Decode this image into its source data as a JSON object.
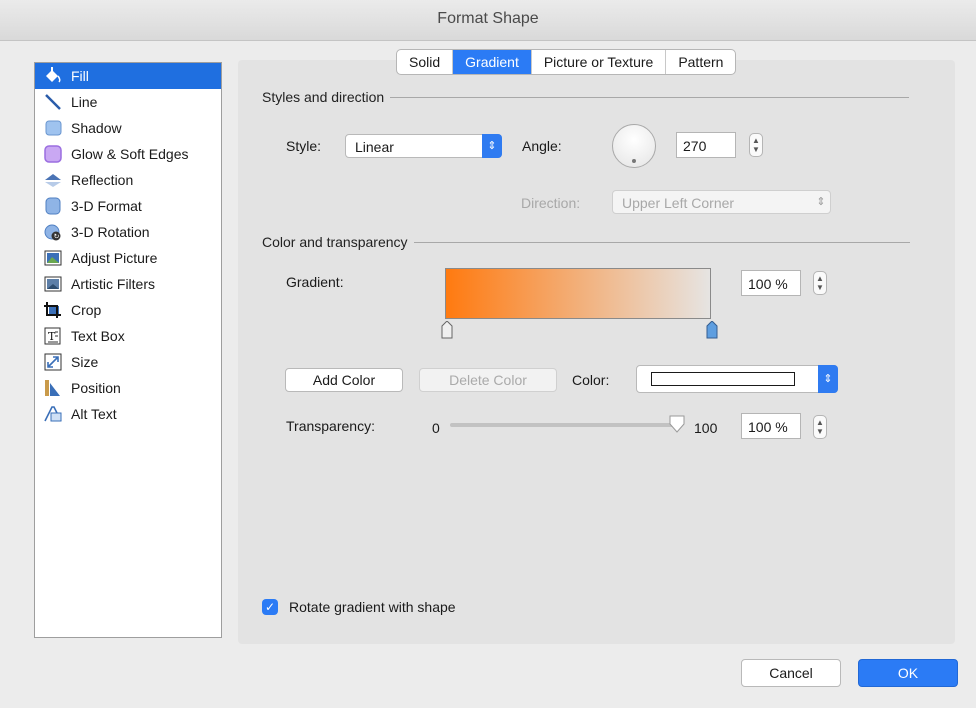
{
  "window": {
    "title": "Format Shape"
  },
  "sidebar": {
    "items": [
      {
        "label": "Fill",
        "icon": "paint-bucket-icon",
        "selected": true
      },
      {
        "label": "Line",
        "icon": "line-icon"
      },
      {
        "label": "Shadow",
        "icon": "shadow-icon"
      },
      {
        "label": "Glow & Soft Edges",
        "icon": "glow-icon"
      },
      {
        "label": "Reflection",
        "icon": "reflection-icon"
      },
      {
        "label": "3-D Format",
        "icon": "3d-format-icon"
      },
      {
        "label": "3-D Rotation",
        "icon": "3d-rotation-icon"
      },
      {
        "label": "Adjust Picture",
        "icon": "adjust-picture-icon"
      },
      {
        "label": "Artistic Filters",
        "icon": "artistic-filters-icon"
      },
      {
        "label": "Crop",
        "icon": "crop-icon"
      },
      {
        "label": "Text Box",
        "icon": "text-box-icon"
      },
      {
        "label": "Size",
        "icon": "size-icon"
      },
      {
        "label": "Position",
        "icon": "position-icon"
      },
      {
        "label": "Alt Text",
        "icon": "alt-text-icon"
      }
    ]
  },
  "tabs": [
    "Solid",
    "Gradient",
    "Picture or Texture",
    "Pattern"
  ],
  "active_tab": "Gradient",
  "styles": {
    "heading": "Styles and direction",
    "style_label": "Style:",
    "style_value": "Linear",
    "angle_label": "Angle:",
    "angle_value": "270",
    "direction_label": "Direction:",
    "direction_value": "Upper Left Corner"
  },
  "color": {
    "heading": "Color and transparency",
    "gradient_label": "Gradient:",
    "gradient_start_color": "#ff7a10",
    "gradient_end_color": "#e6e4e2",
    "stop_percent": "100 %",
    "add_color": "Add Color",
    "delete_color": "Delete Color",
    "color_label": "Color:",
    "transparency_label": "Transparency:",
    "transparency_min": "0",
    "transparency_max": "100",
    "transparency_value": "100 %",
    "transparency_fraction": 1.0
  },
  "rotate": {
    "label": "Rotate gradient with shape",
    "checked": true
  },
  "buttons": {
    "cancel": "Cancel",
    "ok": "OK"
  },
  "accent_color": "#2b7bf5"
}
